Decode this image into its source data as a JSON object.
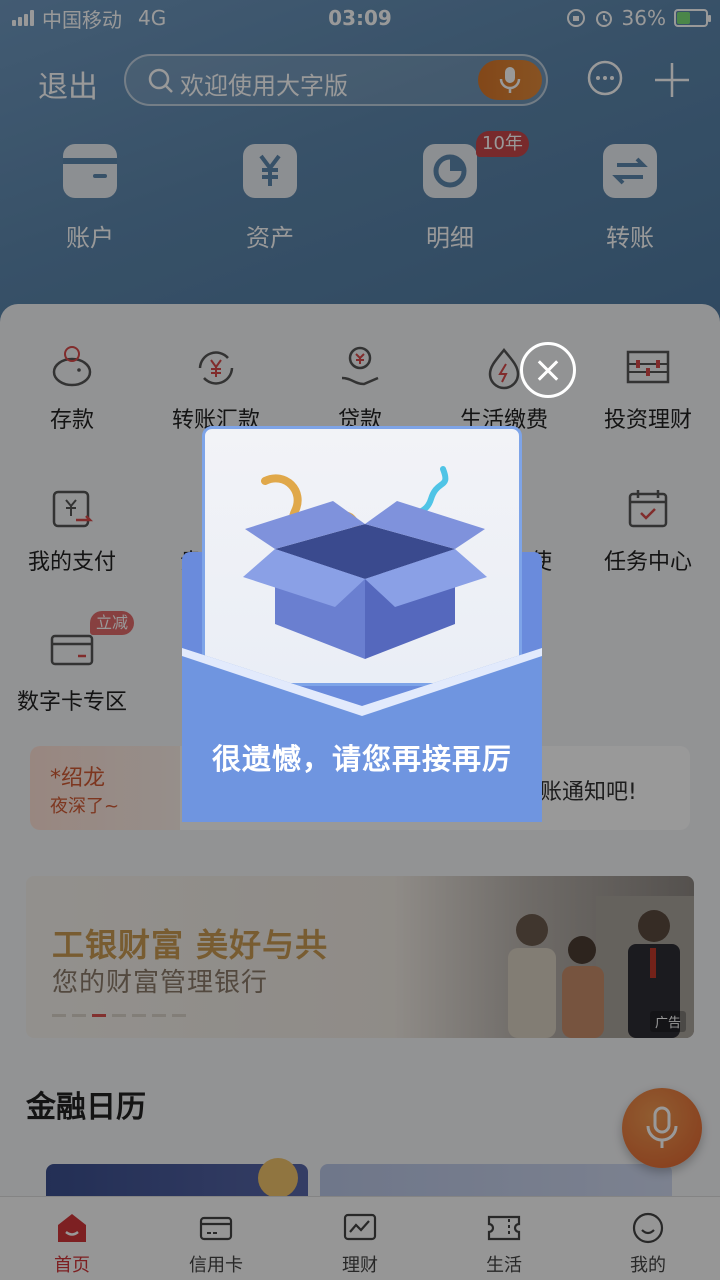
{
  "status_bar": {
    "carrier": "中国移动",
    "network": "4G",
    "time": "03:09",
    "battery": "36%"
  },
  "header": {
    "logout_label": "退出",
    "search_placeholder": "欢迎使用大字版",
    "quick_actions": [
      {
        "label": "账户",
        "icon": "card-icon"
      },
      {
        "label": "资产",
        "icon": "yuan-icon"
      },
      {
        "label": "明细",
        "icon": "pie-chart-icon",
        "badge": "10年"
      },
      {
        "label": "转账",
        "icon": "transfer-arrows-icon"
      }
    ]
  },
  "services": [
    {
      "label": "存款",
      "icon": "piggy-bank-icon"
    },
    {
      "label": "转账汇款",
      "icon": "yuan-exchange-icon"
    },
    {
      "label": "贷款",
      "icon": "loan-hand-icon"
    },
    {
      "label": "生活缴费",
      "icon": "utility-bolt-icon"
    },
    {
      "label": "投资理财",
      "icon": "abacus-icon"
    },
    {
      "label": "我的支付",
      "icon": "payment-icon"
    },
    {
      "label": "贵",
      "icon": ""
    },
    {
      "label": "使",
      "icon": ""
    },
    {
      "label": "任务中心",
      "icon": "calendar-check-icon"
    },
    {
      "label": "数字卡专区",
      "icon": "digital-card-icon",
      "tag": "立减"
    }
  ],
  "notice": {
    "name": "*绍龙",
    "greeting": "夜深了~",
    "message": "账通知吧!"
  },
  "banner": {
    "title": "工银财富  美好与共",
    "subtitle": "您的财富管理银行",
    "ad_label": "广告"
  },
  "calendar": {
    "title": "金融日历"
  },
  "tabbar": [
    {
      "label": "首页",
      "active": true
    },
    {
      "label": "信用卡",
      "active": false
    },
    {
      "label": "理财",
      "active": false
    },
    {
      "label": "生活",
      "active": false
    },
    {
      "label": "我的",
      "active": false
    }
  ],
  "popup": {
    "message": "很遗憾，请您再接再厉"
  },
  "colors": {
    "accent_red": "#d0363a",
    "header_blue": "#5d87ad",
    "popup_blue": "#6a8bdc"
  }
}
